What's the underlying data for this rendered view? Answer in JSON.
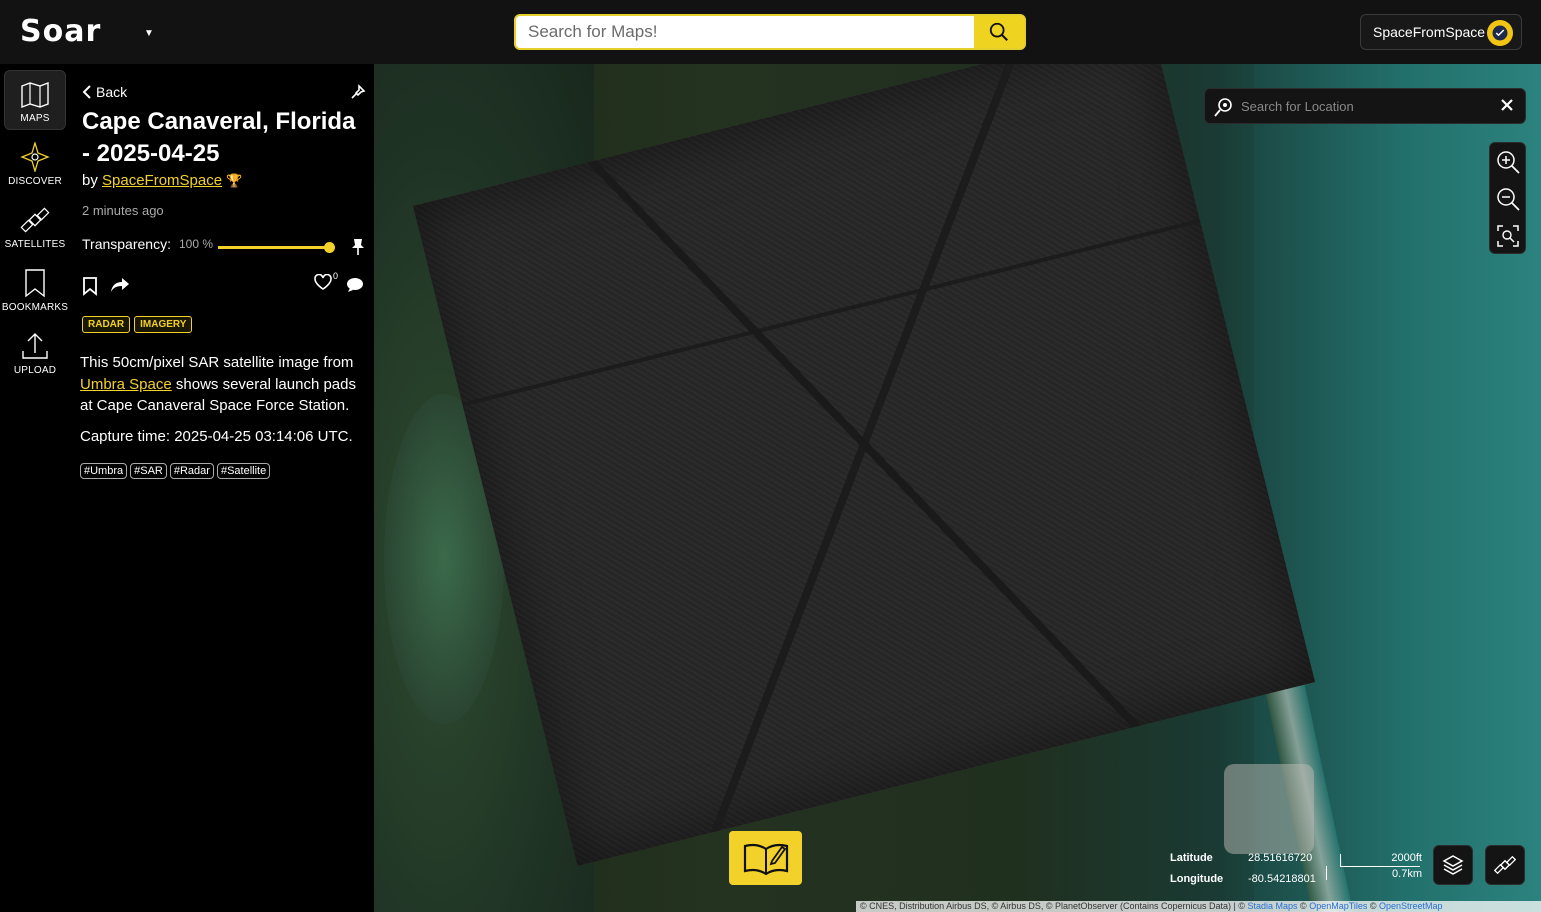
{
  "app": {
    "logo": "Soar"
  },
  "header": {
    "search_placeholder": "Search for Maps!",
    "user_name": "SpaceFromSpace"
  },
  "nav": [
    {
      "label": "MAPS",
      "icon": "map-icon",
      "active": true
    },
    {
      "label": "DISCOVER",
      "icon": "discover-icon",
      "active": false
    },
    {
      "label": "SATELLITES",
      "icon": "satellite-icon",
      "active": false
    },
    {
      "label": "BOOKMARKS",
      "icon": "bookmark-icon",
      "active": false
    },
    {
      "label": "UPLOAD",
      "icon": "upload-icon",
      "active": false
    }
  ],
  "panel": {
    "back_label": "Back",
    "title": "Cape Canaveral, Florida - 2025-04-25",
    "by_prefix": "by",
    "author": "SpaceFromSpace",
    "time_ago": "2 minutes ago",
    "transparency_label": "Transparency:",
    "transparency_value": "100 %",
    "transparency_fraction": 1.0,
    "like_count": "0",
    "categories": [
      "RADAR",
      "IMAGERY"
    ],
    "desc_part1": "This 50cm/pixel SAR satellite image from ",
    "desc_link": "Umbra Space",
    "desc_part2": " shows several launch pads at Cape Canaveral Space Force Station.",
    "capture": "Capture time: 2025-04-25 03:14:06 UTC.",
    "hashtags": [
      "#Umbra",
      "#SAR",
      "#Radar",
      "#Satellite"
    ]
  },
  "map": {
    "location_placeholder": "Search for Location",
    "latitude_label": "Latitude",
    "latitude_value": "28.51616720",
    "longitude_label": "Longitude",
    "longitude_value": "-80.54218801",
    "scale_ft": "2000ft",
    "scale_km": "0.7km",
    "attribution": "© CNES, Distribution Airbus DS, © Airbus DS, © PlanetObserver (Contains Copernicus Data) | © ",
    "attr_links": [
      "Stadia Maps",
      "OpenMapTiles",
      "OpenStreetMap"
    ]
  },
  "colors": {
    "accent": "#f2d12b",
    "background": "#000000"
  }
}
